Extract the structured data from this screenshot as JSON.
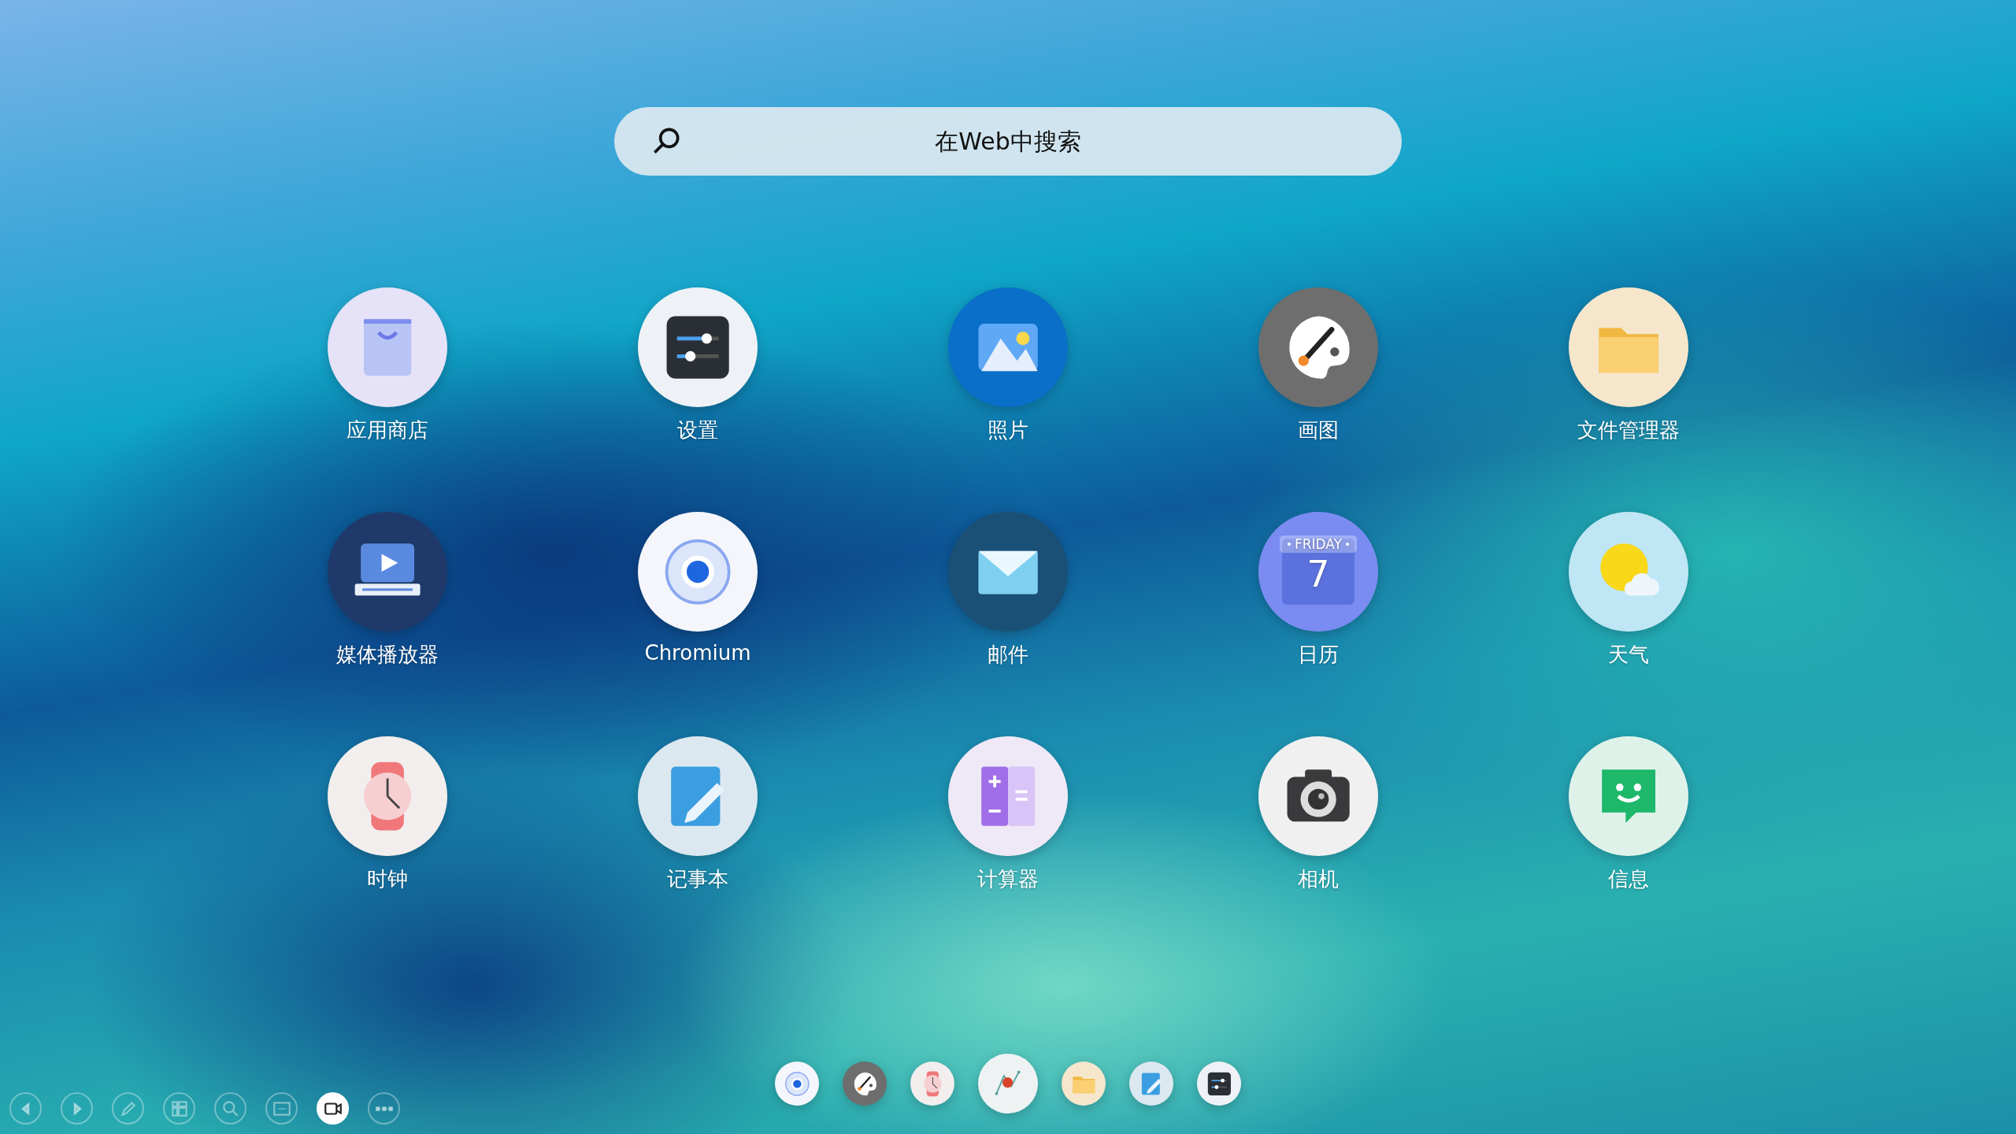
{
  "search": {
    "placeholder": "在Web中搜索"
  },
  "apps": [
    {
      "kind": "store",
      "label": "应用商店"
    },
    {
      "kind": "settings",
      "label": "设置"
    },
    {
      "kind": "photos",
      "label": "照片"
    },
    {
      "kind": "paint",
      "label": "画图"
    },
    {
      "kind": "files",
      "label": "文件管理器"
    },
    {
      "kind": "media",
      "label": "媒体播放器"
    },
    {
      "kind": "chromium",
      "label": "Chromium"
    },
    {
      "kind": "mail",
      "label": "邮件"
    },
    {
      "kind": "calendar",
      "label": "日历",
      "weekday": "FRIDAY",
      "date": "7"
    },
    {
      "kind": "weather",
      "label": "天气"
    },
    {
      "kind": "clock",
      "label": "时钟"
    },
    {
      "kind": "notes",
      "label": "记事本"
    },
    {
      "kind": "calculator",
      "label": "计算器"
    },
    {
      "kind": "camera",
      "label": "相机"
    },
    {
      "kind": "messages",
      "label": "信息"
    }
  ],
  "toolbar": [
    {
      "kind": "back",
      "selected": false
    },
    {
      "kind": "forward",
      "selected": false
    },
    {
      "kind": "pen",
      "selected": false
    },
    {
      "kind": "windows",
      "selected": false
    },
    {
      "kind": "zoom",
      "selected": false
    },
    {
      "kind": "whiteboard",
      "selected": false
    },
    {
      "kind": "video",
      "selected": true
    },
    {
      "kind": "more",
      "selected": false
    }
  ],
  "dock": [
    {
      "kind": "chromium",
      "large": false
    },
    {
      "kind": "paint",
      "large": false
    },
    {
      "kind": "clock",
      "large": false
    },
    {
      "kind": "presentation",
      "large": true
    },
    {
      "kind": "files",
      "large": false
    },
    {
      "kind": "notes",
      "large": false
    },
    {
      "kind": "settings",
      "large": false
    }
  ]
}
